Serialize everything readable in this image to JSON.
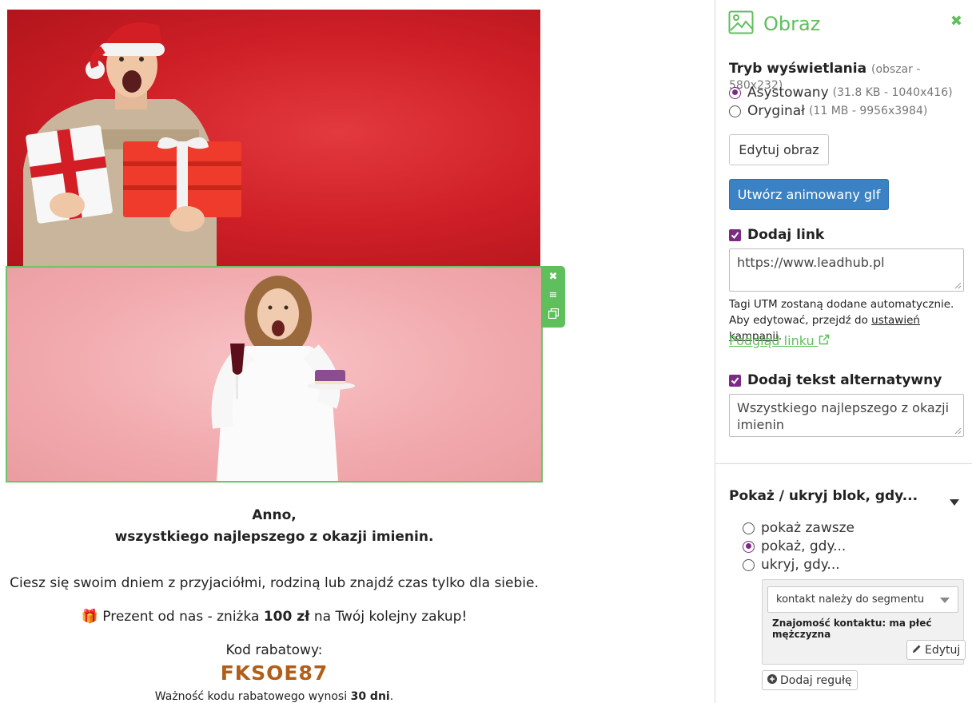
{
  "email": {
    "greeting_line1": "Anno,",
    "greeting_line2": "wszystkiego najlepszego z okazji imienin.",
    "paragraph1": "Ciesz się swoim dniem z przyjaciółmi, rodziną lub znajdź czas tylko dla siebie.",
    "gift_icon": "🎁",
    "gift_text_before": " Prezent od nas - zniżka ",
    "gift_amount": "100 zł",
    "gift_text_after": " na Twój kolejny zakup!",
    "code_label": "Kod rabatowy:",
    "code_value": "FKSOE87",
    "validity_before": "Ważność kodu rabatowego wynosi ",
    "validity_days": "30 dni",
    "validity_after": "."
  },
  "block_toolbar": {
    "icons": [
      "close-icon",
      "drag-handle-icon",
      "duplicate-icon"
    ]
  },
  "panel": {
    "title": "Obraz",
    "title_icon": "image-icon",
    "close_icon": "close-icon",
    "display_mode": {
      "heading": "Tryb wyświetlania",
      "area_note": "(obszar - 580x232)",
      "options": [
        {
          "label": "Asystowany",
          "note": "(31.8 KB - 1040x416)",
          "selected": true
        },
        {
          "label": "Oryginał",
          "note": "(11 MB - 9956x3984)",
          "selected": false
        }
      ]
    },
    "edit_image_button": "Edytuj obraz",
    "create_gif_button": "Utwórz animowany gIf",
    "add_link": {
      "label": "Dodaj link",
      "checked": true,
      "url": "https://www.leadhub.pl",
      "help_text": "Tagi UTM zostaną dodane automatycznie. Aby edytować, przejdź do ",
      "help_link": "ustawień kampanii",
      "help_end": ".",
      "preview_link": "Podgląd linku"
    },
    "alt_text": {
      "label": "Dodaj tekst alternatywny",
      "checked": true,
      "value": "Wszystkiego najlepszego z okazji imienin"
    },
    "visibility": {
      "heading": "Pokaż / ukryj blok, gdy...",
      "options": [
        {
          "label": "pokaż zawsze",
          "selected": false
        },
        {
          "label": "pokaż, gdy...",
          "selected": true
        },
        {
          "label": "ukryj, gdy...",
          "selected": false
        }
      ],
      "rule_select": "kontakt należy do segmentu",
      "rule_description": "Znajomość kontaktu: ma płeć mężczyzna",
      "edit_button": "Edytuj",
      "add_rule_button": "Dodaj regułę"
    }
  },
  "colors": {
    "accent_green": "#5fbf5c",
    "primary_blue": "#3a82c4",
    "checkbox_purple": "#7b2b84",
    "code_orange": "#b15e1a"
  }
}
